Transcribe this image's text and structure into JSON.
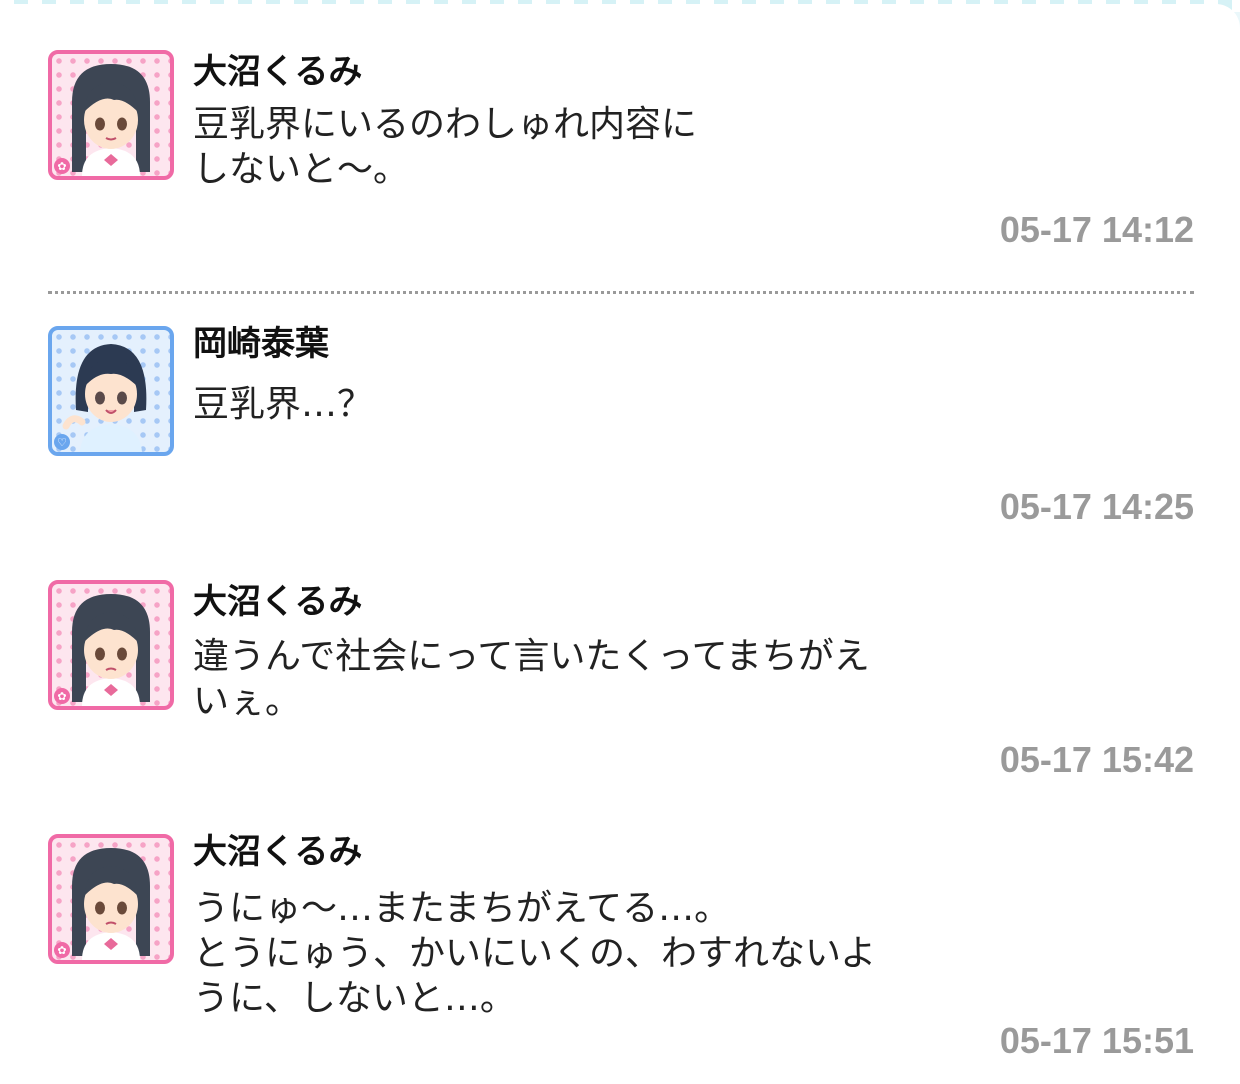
{
  "messages": [
    {
      "sender": "大沼くるみ",
      "avatar_icon": "kurumi-avatar-icon",
      "avatar_color": "#f06aa6",
      "text": "豆乳界にいるのわしゅれ内容に\nしないと〜。",
      "time": "05-17 14:12"
    },
    {
      "sender": "岡崎泰葉",
      "avatar_icon": "yasuha-avatar-icon",
      "avatar_color": "#6aa6ee",
      "text": "豆乳界…？",
      "time": "05-17 14:25"
    },
    {
      "sender": "大沼くるみ",
      "avatar_icon": "kurumi-avatar-icon",
      "avatar_color": "#f06aa6",
      "text": "違うんで社会にって言いたくってまちがえ\nいぇ。",
      "time": "05-17 15:42"
    },
    {
      "sender": "大沼くるみ",
      "avatar_icon": "kurumi-avatar-icon",
      "avatar_color": "#f06aa6",
      "text": "うにゅ〜…またまちがえてる…。\nとうにゅう、かいにいくの、わすれないよ\nうに、しないと…。",
      "time": "05-17 15:51"
    }
  ]
}
